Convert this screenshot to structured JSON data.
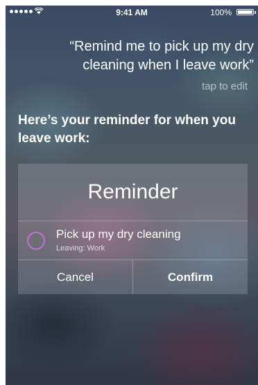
{
  "status_bar": {
    "time": "9:41 AM",
    "battery": "100%",
    "signal_icon": "signal-dots-icon",
    "wifi_icon": "wifi-icon",
    "battery_icon": "battery-icon"
  },
  "query": {
    "text": "“Remind me to pick up my dry cleaning when I leave work”",
    "edit_label": "tap to edit"
  },
  "response": {
    "text": "Here’s your reminder for when you leave work:"
  },
  "card": {
    "title": "Reminder",
    "item_title": "Pick up my dry cleaning",
    "item_subtitle": "Leaving: Work",
    "checkbox_color": "#c46fd9",
    "cancel_label": "Cancel",
    "confirm_label": "Confirm"
  }
}
